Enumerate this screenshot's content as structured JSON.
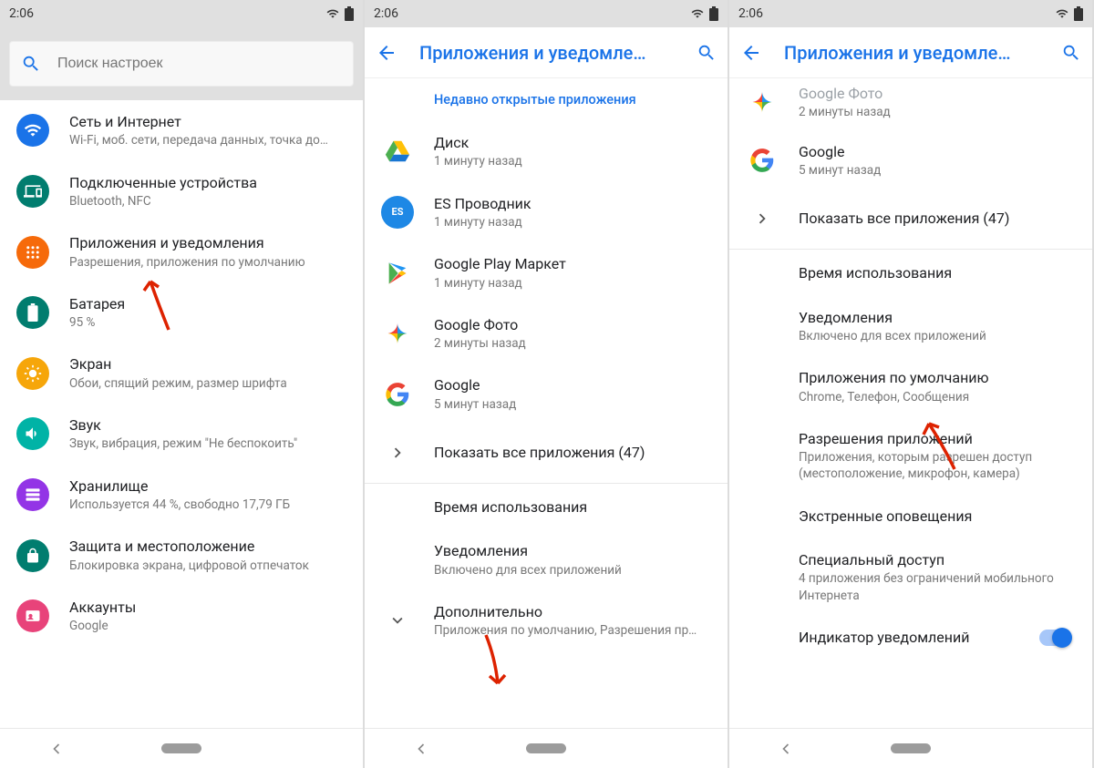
{
  "status": {
    "time": "2:06"
  },
  "screen1": {
    "search_placeholder": "Поиск настроек",
    "items": [
      {
        "title": "Сеть и Интернет",
        "sub": "Wi-Fi, моб. сети, передача данных, точка до…"
      },
      {
        "title": "Подключенные устройства",
        "sub": "Bluetooth, NFC"
      },
      {
        "title": "Приложения и уведомления",
        "sub": "Разрешения, приложения по умолчанию"
      },
      {
        "title": "Батарея",
        "sub": "95 %"
      },
      {
        "title": "Экран",
        "sub": "Обои, спящий режим, размер шрифта"
      },
      {
        "title": "Звук",
        "sub": "Звук, вибрация, режим \"Не беспокоить\""
      },
      {
        "title": "Хранилище",
        "sub": "Используется 44 %, свободно 17,79 ГБ"
      },
      {
        "title": "Защита и местоположение",
        "sub": "Блокировка экрана, цифровой отпечаток"
      },
      {
        "title": "Аккаунты",
        "sub": "Google"
      }
    ]
  },
  "screen2": {
    "title": "Приложения и уведомле…",
    "recent_label": "Недавно открытые приложения",
    "apps": [
      {
        "title": "Диск",
        "sub": "1 минуту назад"
      },
      {
        "title": "ES Проводник",
        "sub": "1 минуту назад"
      },
      {
        "title": "Google Play Маркет",
        "sub": "1 минуту назад"
      },
      {
        "title": "Google Фото",
        "sub": "2 минуты назад"
      },
      {
        "title": "Google",
        "sub": "5 минут назад"
      }
    ],
    "show_all": "Показать все приложения (47)",
    "usage": "Время использования",
    "notif": {
      "title": "Уведомления",
      "sub": "Включено для всех приложений"
    },
    "advanced": {
      "title": "Дополнительно",
      "sub": "Приложения по умолчанию, Разрешения пр…"
    }
  },
  "screen3": {
    "title": "Приложения и уведомле…",
    "apps_top": [
      {
        "title": "Google Фото",
        "sub": "2 минуты назад"
      },
      {
        "title": "Google",
        "sub": "5 минут назад"
      }
    ],
    "show_all": "Показать все приложения (47)",
    "usage": "Время использования",
    "notif": {
      "title": "Уведомления",
      "sub": "Включено для всех приложений"
    },
    "default_apps": {
      "title": "Приложения по умолчанию",
      "sub": "Chrome, Телефон, Сообщения"
    },
    "perms": {
      "title": "Разрешения приложений",
      "sub": "Приложения, которым разрешен доступ (местоположение, микрофон, камера)"
    },
    "emergency": "Экстренные оповещения",
    "special": {
      "title": "Специальный доступ",
      "sub": "4 приложения без ограничений мобильного Интернета"
    },
    "indicator": "Индикатор уведомлений"
  }
}
